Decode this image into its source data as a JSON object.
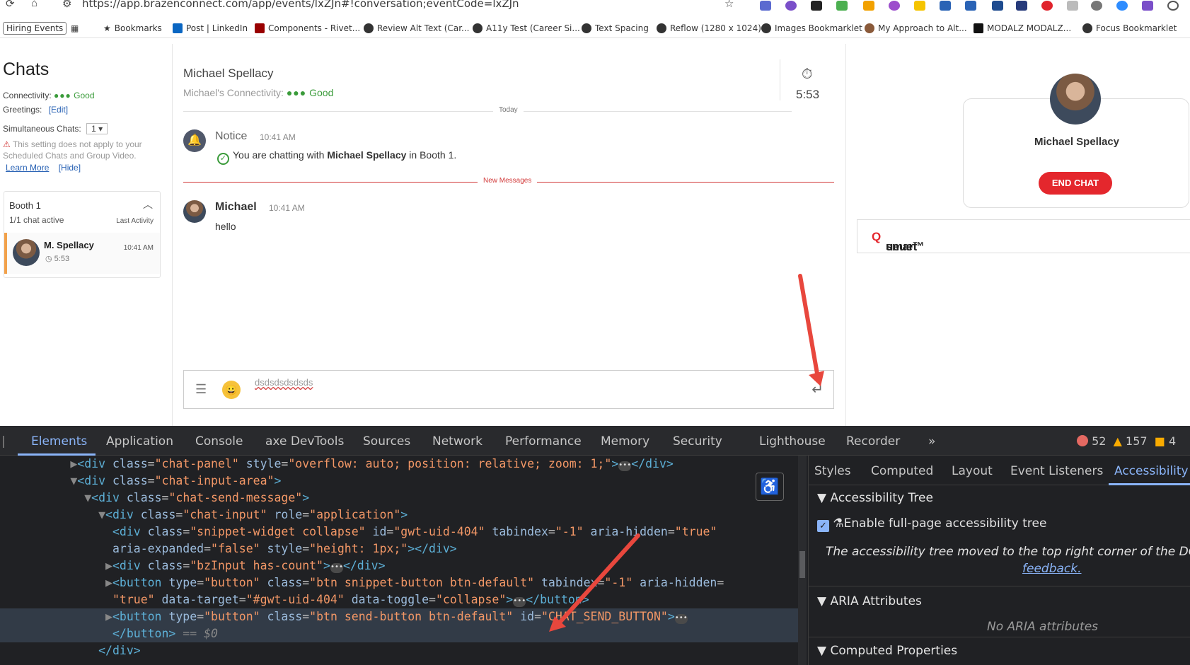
{
  "browser": {
    "url": "https://app.brazenconnect.com/app/events/lxZJn#!conversation;eventCode=lxZJn",
    "bookmarks": [
      {
        "label": "Hiring Events"
      },
      {
        "label": "Bookmarks"
      },
      {
        "label": "Post | LinkedIn"
      },
      {
        "label": "Components - Rivet..."
      },
      {
        "label": "Review Alt Text (Car..."
      },
      {
        "label": "A11y Test (Career Si..."
      },
      {
        "label": "Text Spacing"
      },
      {
        "label": "Reflow (1280 x 1024)"
      },
      {
        "label": "Images Bookmarklet"
      },
      {
        "label": "My Approach to Alt..."
      },
      {
        "label": "MODALZ MODALZ..."
      },
      {
        "label": "Focus Bookmarklet"
      }
    ]
  },
  "left": {
    "title": "Chats",
    "connectivity_label": "Connectivity:",
    "connectivity_dots": "●●●",
    "connectivity_value": "Good",
    "greetings_label": "Greetings:",
    "greetings_edit": "[Edit]",
    "simultaneous_label": "Simultaneous Chats:",
    "simultaneous_value": "1",
    "warning": "This setting does not apply to your Scheduled Chats and Group Video.",
    "learn_more": "Learn More",
    "hide": "[Hide]",
    "booth": {
      "title": "Booth 1",
      "status": "1/1 chat active",
      "last_activity": "Last Activity",
      "item": {
        "name": "M. Spellacy",
        "timer": "5:53",
        "time": "10:41 AM"
      }
    }
  },
  "chat": {
    "name": "Michael Spellacy",
    "connectivity_label": "Michael's Connectivity:",
    "connectivity_dots": "●●●",
    "connectivity_value": "Good",
    "timer": "5:53",
    "today": "Today",
    "notice": {
      "title": "Notice",
      "time": "10:41 AM",
      "prefix": "You are chatting with ",
      "name": "Michael Spellacy",
      "suffix": " in Booth 1."
    },
    "new_messages": "New Messages",
    "message": {
      "sender": "Michael",
      "time": "10:41 AM",
      "text": "hello"
    },
    "input_value": "dsdsdsdsdsds"
  },
  "right": {
    "name": "Michael Spellacy",
    "end_chat": "END CHAT",
    "smartqueue_a": "smart",
    "smartqueue_b": "Q",
    "smartqueue_c": "ueue™"
  },
  "devtools": {
    "tabs": [
      "Elements",
      "Application",
      "Console",
      "axe DevTools",
      "Sources",
      "Network",
      "Performance",
      "Memory",
      "Security",
      "Lighthouse",
      "Recorder",
      "»"
    ],
    "errors": "52",
    "warnings": "157",
    "issues": "4",
    "side_tabs": [
      "Styles",
      "Computed",
      "Layout",
      "Event Listeners",
      "Accessibility"
    ],
    "accessibility_tree": "Accessibility Tree",
    "enable_tree": "Enable full-page accessibility tree",
    "tree_note": "The accessibility tree moved to the top right corner of the DOM tree",
    "feedback": "feedback.",
    "aria_attributes": "ARIA Attributes",
    "no_aria": "No ARIA attributes",
    "computed_properties": "Computed Properties"
  },
  "colors": {
    "accent_red": "#e4272d",
    "good_green": "#3a9b3a",
    "devtools_blue": "#8ab4f8"
  }
}
